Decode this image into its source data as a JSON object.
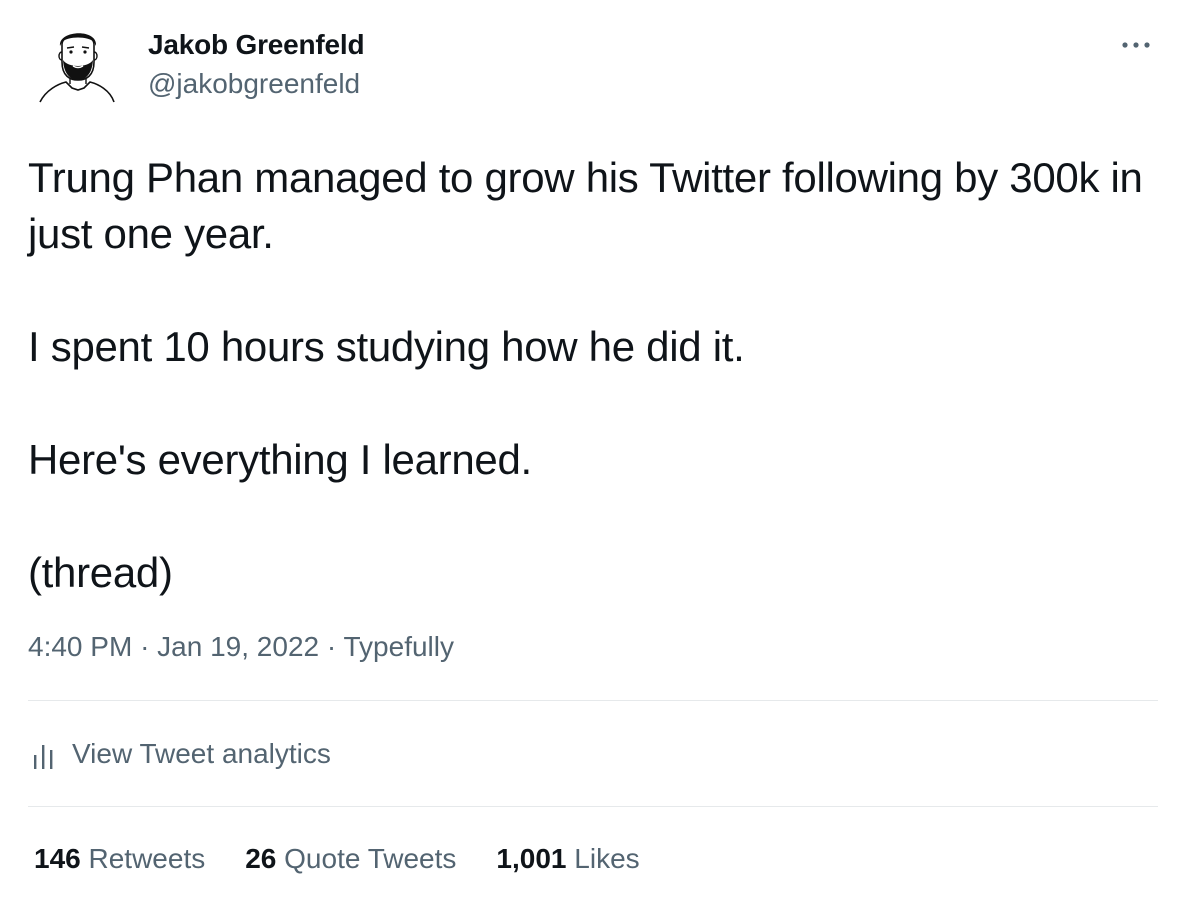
{
  "author": {
    "display_name": "Jakob Greenfeld",
    "handle": "@jakobgreenfeld"
  },
  "tweet": {
    "paragraphs": [
      "Trung Phan managed to grow his Twitter following by 300k in just one year.",
      "I spent 10 hours studying how he did it.",
      "Here's everything I learned.",
      "(thread)"
    ],
    "time": "4:40 PM",
    "separator": "·",
    "date": "Jan 19, 2022",
    "source": "Typefully"
  },
  "analytics": {
    "label": "View Tweet analytics",
    "icon": "analytics-bar-icon"
  },
  "stats": {
    "retweets_count": "146",
    "retweets_label": "Retweets",
    "quotes_count": "26",
    "quotes_label": "Quote Tweets",
    "likes_count": "1,001",
    "likes_label": "Likes"
  },
  "icons": {
    "more": "more-dots-icon",
    "avatar": "avatar-illustration"
  },
  "colors": {
    "text_primary": "#0f1419",
    "text_secondary": "#536471",
    "divider": "#e6e9eb"
  }
}
